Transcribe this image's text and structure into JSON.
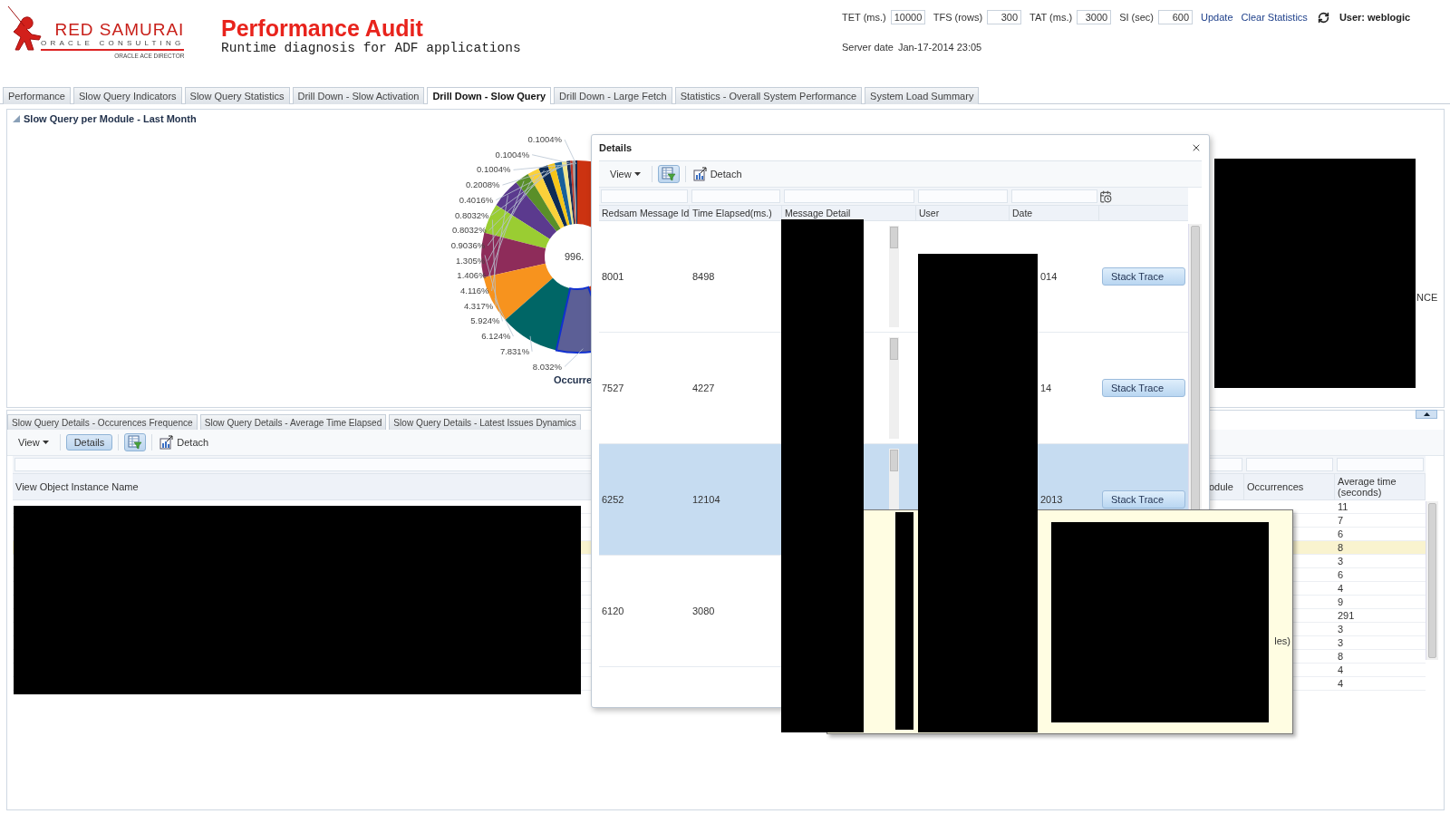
{
  "logo": {
    "name": "RED SAMURAI",
    "tagline": "ORACLE CONSULTING",
    "badge": "ORACLE ACE DIRECTOR"
  },
  "header": {
    "title": "Performance Audit",
    "subtitle": "Runtime diagnosis for ADF applications"
  },
  "settings": [
    {
      "label": "TET (ms.)",
      "value": "10000"
    },
    {
      "label": "TFS (rows)",
      "value": "300"
    },
    {
      "label": "TAT (ms.)",
      "value": "3000"
    },
    {
      "label": "SI (sec)",
      "value": "600"
    }
  ],
  "links": [
    "Update",
    "Clear Statistics"
  ],
  "user": "User: weblogic",
  "server_date": {
    "label": "Server date",
    "value": "Jan-17-2014 23:05"
  },
  "tabs": [
    {
      "label": "Performance",
      "selected": false
    },
    {
      "label": "Slow Query Indicators",
      "selected": false
    },
    {
      "label": "Slow Query Statistics",
      "selected": false
    },
    {
      "label": "Drill Down - Slow Activation",
      "selected": false
    },
    {
      "label": "Drill Down - Slow Query",
      "selected": true
    },
    {
      "label": "Drill Down - Large Fetch",
      "selected": false
    },
    {
      "label": "Statistics - Overall System Performance",
      "selected": false
    },
    {
      "label": "System Load Summary",
      "selected": false
    }
  ],
  "chart_panel": {
    "title": "Slow Query per Module - Last Month",
    "center_label": "996.",
    "caption": "Occurre",
    "side_fragment": "NCE",
    "slice_labels": [
      "0.1004%",
      "0.1004%",
      "0.1004%",
      "0.2008%",
      "0.4016%",
      "0.8032%",
      "0.8032%",
      "0.9036%",
      "1.305%",
      "1.406%",
      "4.116%",
      "4.317%",
      "5.924%",
      "6.124%",
      "7.831%",
      "8.032%"
    ]
  },
  "detail_tabs": [
    {
      "label": "Slow Query Details - Occurences Frequence",
      "selected": false
    },
    {
      "label": "Slow Query Details - Average Time Elapsed",
      "selected": false
    },
    {
      "label": "Slow Query Details - Latest Issues Dynamics",
      "selected": false
    }
  ],
  "toolbar": {
    "view": "View",
    "details": {
      "label": "Details",
      "selected": true
    },
    "filter": {
      "selected": true
    },
    "detach": "Detach"
  },
  "table": {
    "columns": [
      "View Object Instance Name",
      "odule",
      "Occurrences",
      "Average time (seconds)"
    ],
    "rows": [
      {
        "average": "11",
        "selected": false
      },
      {
        "average": "7",
        "selected": false
      },
      {
        "average": "6",
        "selected": false
      },
      {
        "average": "8",
        "selected": true
      },
      {
        "average": "3",
        "selected": false
      },
      {
        "average": "6",
        "selected": false
      },
      {
        "average": "4",
        "selected": false
      },
      {
        "average": "9",
        "selected": false
      },
      {
        "average": "291",
        "selected": false
      },
      {
        "average": "3",
        "selected": false
      },
      {
        "average": "3",
        "selected": false
      },
      {
        "average": "8",
        "selected": false
      },
      {
        "average": "4",
        "selected": false
      },
      {
        "average": "4",
        "selected": false
      }
    ]
  },
  "dialog": {
    "title": "Details",
    "toolbar": {
      "view": "View",
      "filter": {
        "selected": true
      },
      "detach": "Detach"
    },
    "columns": [
      "Redsam Message Id",
      "Time Elapsed(ms.)",
      "Message Detail",
      "User",
      "Date"
    ],
    "rows": [
      {
        "id": "8001",
        "elapsed": "8498",
        "date": "014",
        "action": "Stack Trace",
        "selected": false
      },
      {
        "id": "7527",
        "elapsed": "4227",
        "date": "14",
        "action": "Stack Trace",
        "selected": false
      },
      {
        "id": "6252",
        "elapsed": "12104",
        "date": "2013",
        "action": "Stack Trace",
        "selected": true
      },
      {
        "id": "6120",
        "elapsed": "3080",
        "selected": false
      }
    ]
  },
  "tooltip": {
    "fragment": "les)"
  }
}
